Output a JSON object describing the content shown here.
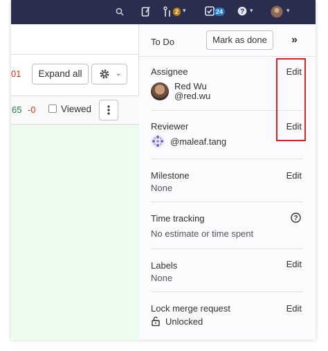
{
  "navbar": {
    "merge_badge": "2",
    "todo_badge": "24"
  },
  "diff": {
    "stat_partial": "01",
    "expand_all": "Expand all",
    "additions": "65",
    "deletions": "-0",
    "viewed_label": "Viewed"
  },
  "sidebar": {
    "todo_label": "To Do",
    "mark_done": "Mark as done",
    "assignee": {
      "title": "Assignee",
      "edit": "Edit",
      "name": "Red Wu",
      "username": "@red.wu"
    },
    "reviewer": {
      "title": "Reviewer",
      "edit": "Edit",
      "username": "@maleaf.tang"
    },
    "milestone": {
      "title": "Milestone",
      "edit": "Edit",
      "value": "None"
    },
    "time_tracking": {
      "title": "Time tracking",
      "value": "No estimate or time spent"
    },
    "labels": {
      "title": "Labels",
      "edit": "Edit",
      "value": "None"
    },
    "lock": {
      "title": "Lock merge request",
      "edit": "Edit",
      "value": "Unlocked"
    }
  },
  "colors": {
    "navbar_bg": "#2a2d4e",
    "highlight": "#e01f1f",
    "addition_green": "#108548",
    "deletion_red": "#dd2b0e"
  }
}
